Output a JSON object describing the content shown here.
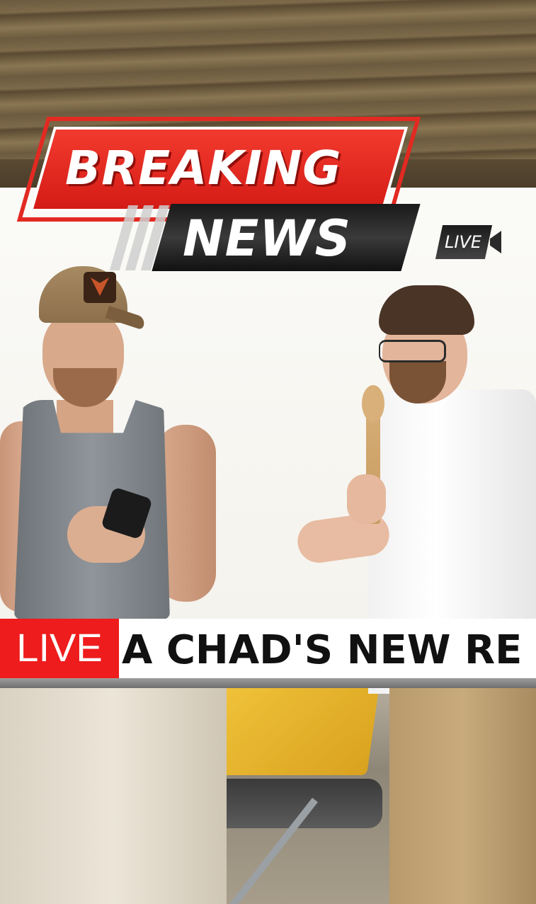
{
  "graphic": {
    "breaking": "BREAKING",
    "news": "NEWS",
    "live_badge": "LIVE"
  },
  "ticker": {
    "live_label": "LIVE",
    "headline": "A CHAD'S NEW RE"
  },
  "colors": {
    "accent_red": "#ee1c1c",
    "banner_dark": "#1a1a1a",
    "ticker_bg": "#ffffff"
  }
}
